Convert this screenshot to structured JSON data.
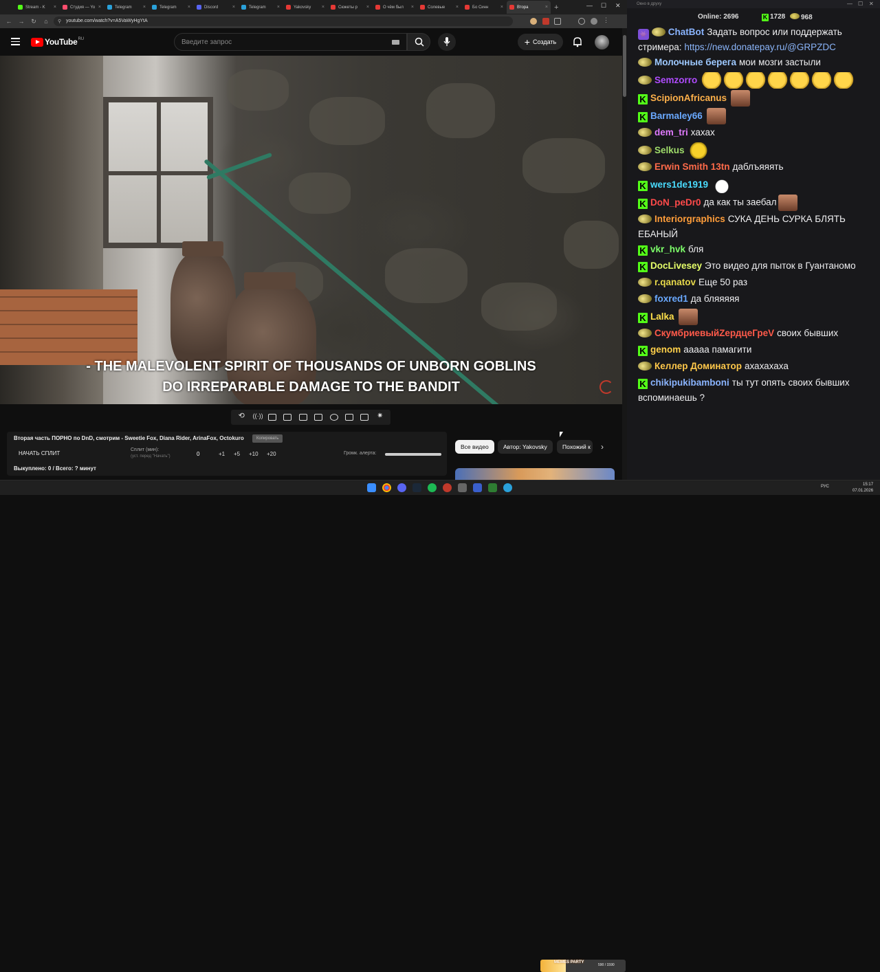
{
  "browser": {
    "tabs": [
      {
        "title": "Stream - K",
        "color": "#53fc18"
      },
      {
        "title": "Студия — Yo",
        "color": "#ff4d6d"
      },
      {
        "title": "Telegram",
        "color": "#2aa1da"
      },
      {
        "title": "Telegram",
        "color": "#2aa1da"
      },
      {
        "title": "Discord",
        "color": "#5865f2"
      },
      {
        "title": "Telegram",
        "color": "#2aa1da"
      },
      {
        "title": "Yakovsky",
        "color": "#e53935"
      },
      {
        "title": "Сюжеты р",
        "color": "#e53935"
      },
      {
        "title": "О чём был",
        "color": "#e53935"
      },
      {
        "title": "Солевые",
        "color": "#e53935"
      },
      {
        "title": "Бо Синн",
        "color": "#e53935"
      },
      {
        "title": "Втора",
        "color": "#e53935",
        "active": true
      }
    ],
    "url": "youtube.com/watch?v=A5VaWyHgYtA",
    "new_tab": "+"
  },
  "youtube": {
    "logo_text": "YouTube",
    "country": "RU",
    "search_placeholder": "Введите запрос",
    "create_label": "Создать",
    "create_plus": "+"
  },
  "video": {
    "subtitle_line1": "- THE MALEVOLENT SPIRIT OF THOUSANDS OF UNBORN GOBLINS",
    "subtitle_line2": "DO IRREPARABLE DAMAGE TO THE BANDIT"
  },
  "extension": {
    "video_title": "Вторая часть ПОРНО по DnD, смотрим - Sweetie Fox, Diana Rider, ArinaFox, Octokuro",
    "copy_label": "Копировать",
    "start_split_label": "НАЧАТЬ СПЛИТ",
    "split_label": "Сплит (мин):",
    "split_hint": "(уст. перед \"Начать\")",
    "split_value": "0",
    "increments": [
      "+1",
      "+5",
      "+10",
      "+20"
    ],
    "alert_volume_label": "Громк. алерта:",
    "alert_volume": 1.0,
    "bought_text": "Выкуплено: 0 / Всего: ? минут"
  },
  "chips": [
    {
      "label": "Все видео",
      "active": true
    },
    {
      "label": "Автор: Yakovsky",
      "active": false
    },
    {
      "label": "Похожий к",
      "active": false
    }
  ],
  "chips_next": "›",
  "chat": {
    "window_title": "Окно в друху",
    "online_label": "Online:",
    "online_count": "2696",
    "kick_count": "1728",
    "other_count": "968",
    "messages": [
      {
        "platform": "chatbot",
        "user": "ChatBot",
        "color": "#8ab4ff",
        "text": "Задать вопрос или поддержать стримера:",
        "link": "https://new.donatepay.ru/@GRPZDC"
      },
      {
        "platform": "trovo",
        "user": "Молочные берега",
        "color": "#9ec9ff",
        "text": "мои мозги застыли"
      },
      {
        "platform": "trovo",
        "user": "Semzorro",
        "color": "#b04cff",
        "text": "",
        "emote": "laugh",
        "emote_count": 7
      },
      {
        "platform": "kick",
        "user": "ScipionAfricanus",
        "color": "#ffb14a",
        "text": "",
        "emote": "face",
        "emote_count": 1
      },
      {
        "platform": "kick",
        "user": "Barmaley66",
        "color": "#6aa9ff",
        "text": "",
        "emote": "face",
        "emote_count": 1
      },
      {
        "platform": "trovo",
        "user": "dem_tri",
        "color": "#e17bff",
        "text": "хахах"
      },
      {
        "platform": "trovo",
        "user": "Selkus",
        "color": "#9fdc6a",
        "text": "",
        "emote": "selk",
        "emote_count": 1
      },
      {
        "platform": "trovo",
        "user": "Erwin Smith 13tn",
        "color": "#ff6b4a",
        "text": "даблъяяять"
      },
      {
        "platform": "kick",
        "user": "wers1de1919",
        "color": "#4adcff",
        "text": "",
        "emote": "hands",
        "emote_count": 1
      },
      {
        "platform": "kick",
        "user": "DoN_peDr0",
        "color": "#ff4a4a",
        "text": "да как ты заебал",
        "emote": "face",
        "emote_count": 1
      },
      {
        "platform": "trovo",
        "user": "Interiorgraphics",
        "color": "#ff9d3a",
        "text": "СУКА ДЕНЬ СУРКА БЛЯТЬ ЕБАНЫЙ"
      },
      {
        "platform": "kick",
        "user": "vkr_hvk",
        "color": "#7dff6a",
        "text": "бля"
      },
      {
        "platform": "kick",
        "user": "DocLivesey",
        "color": "#e6ff6a",
        "text": "Это видео для пыток в Гуантаномо"
      },
      {
        "platform": "trovo",
        "user": "r.qanatov",
        "color": "#e6d84a",
        "text": "Еще 50 раз"
      },
      {
        "platform": "trovo",
        "user": "foxred1",
        "color": "#6aa9ff",
        "text": "да бляяяяя"
      },
      {
        "platform": "kick",
        "user": "Lalka",
        "color": "#ffe04a",
        "text": "",
        "emote": "face",
        "emote_count": 1
      },
      {
        "platform": "trovo",
        "user": "СкумбриевыйZердцеГреV",
        "color": "#ff5a4a",
        "text": "своих бывших"
      },
      {
        "platform": "kick",
        "user": "genom",
        "color": "#ffd04a",
        "text": "ааааа памагити"
      },
      {
        "platform": "trovo",
        "user": "Келлер Доминатор",
        "color": "#ffc84a",
        "text": "ахахахаха"
      },
      {
        "platform": "kick",
        "user": "chikipukibamboni",
        "color": "#8ab4ff",
        "text": "ты тут опять своих бывших вспоминаешь ?"
      }
    ]
  },
  "taskbar": {
    "lang": "РУС",
    "time": "15:17",
    "date": "07.01.2026",
    "widget_title": "MEMES PARTY",
    "widget_count": "590 / 1590"
  }
}
